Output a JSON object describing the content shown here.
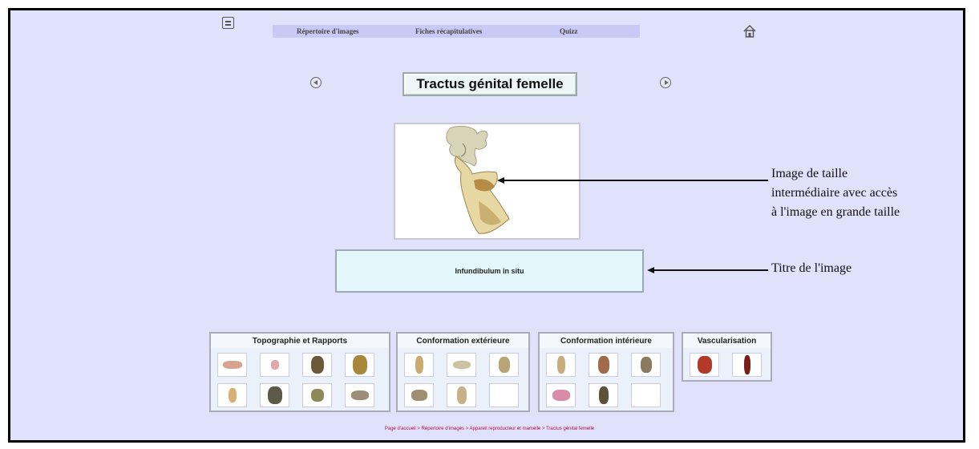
{
  "nav": {
    "items": [
      "Répertoire d'images",
      "Fiches récapitulatives",
      "Quizz"
    ],
    "icons": {
      "menu": "menu-icon",
      "home": "home-icon",
      "prev": "arrow-left-icon",
      "next": "arrow-right-icon"
    }
  },
  "page_title": "Tractus génital femelle",
  "caption": "Infundibulum in situ",
  "annotations": {
    "image": "Image de taille intermédiaire avec accès à l'image en grande taille",
    "image_lines": [
      "Image de taille",
      "intermédiaire avec accès",
      "à l'image en grande taille"
    ],
    "title": "Titre de l'image"
  },
  "groups": [
    {
      "title": "Topographie et Rapports",
      "thumbs": 8
    },
    {
      "title": "Conformation extérieure",
      "thumbs": 5
    },
    {
      "title": "Conformation intérieure",
      "thumbs": 5
    },
    {
      "title": "Vascularisation",
      "thumbs": 2
    }
  ],
  "breadcrumb": "Page d'accueil > Répertoire d'images > Appareil reproducteur et mamelle > Tractus génital femelle",
  "colors": {
    "background": "#e0e1fb",
    "navbar": "#c9c9f6",
    "caption_bg": "#e4f8fb",
    "breadcrumb": "#b01050"
  }
}
